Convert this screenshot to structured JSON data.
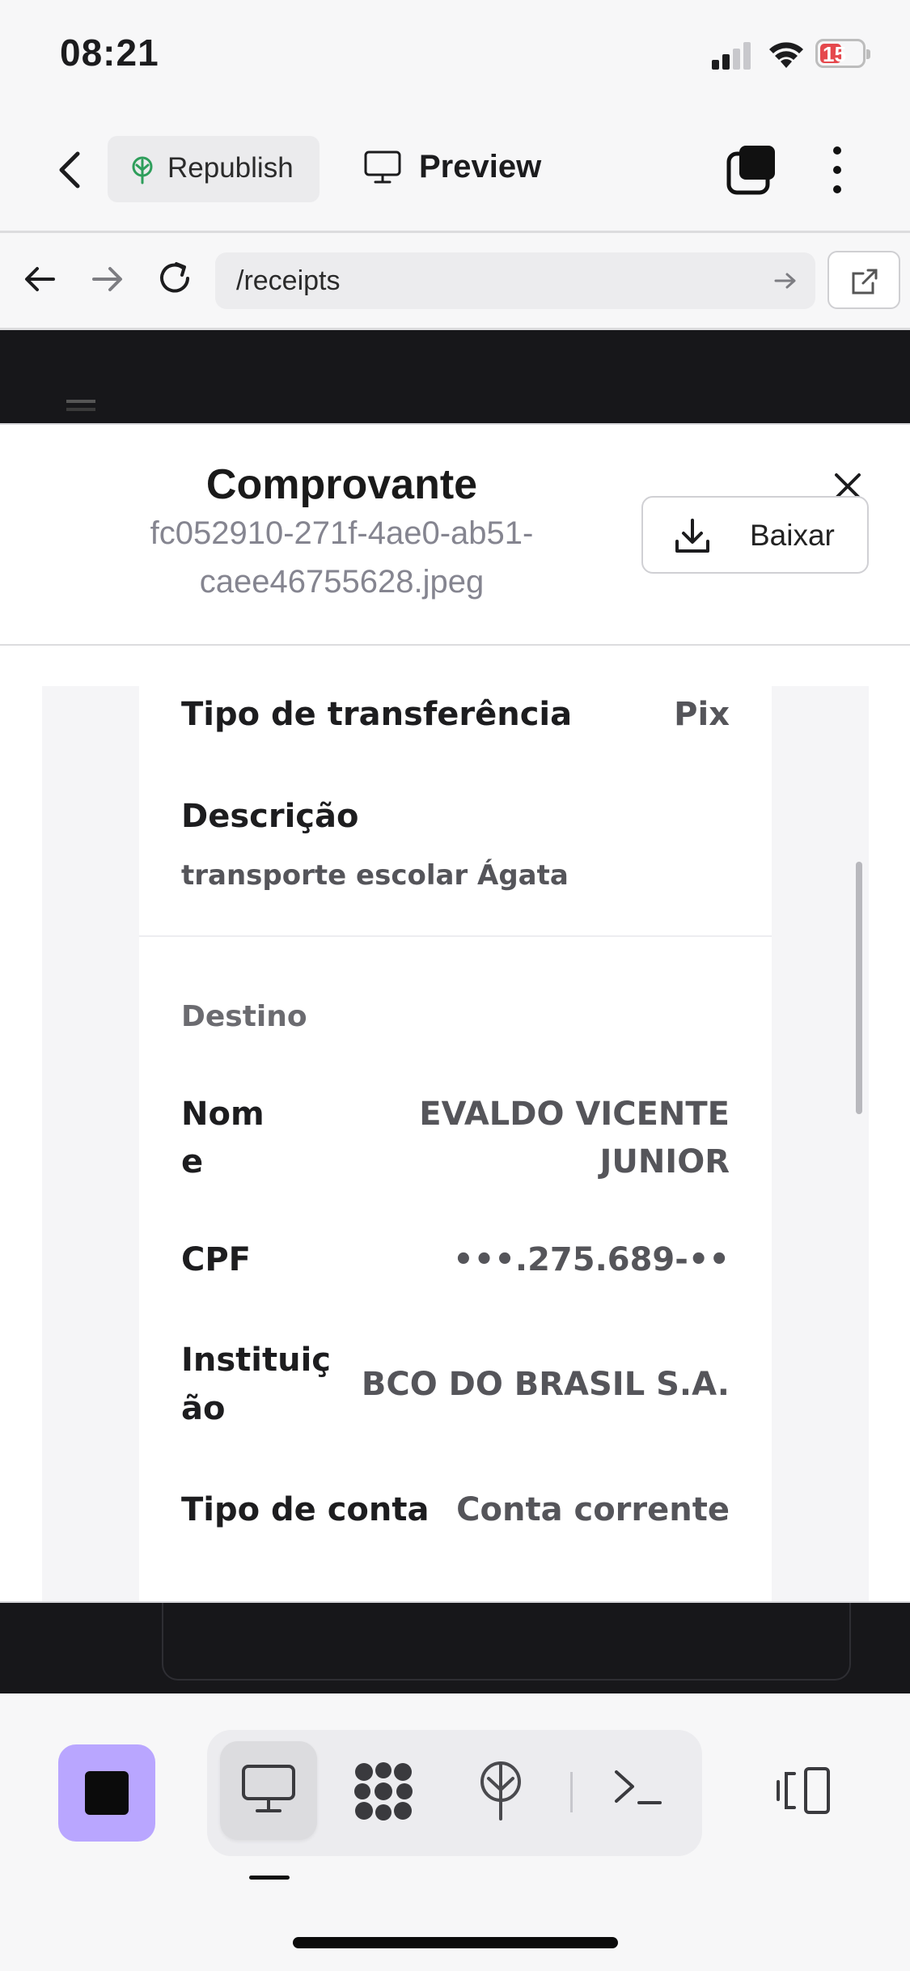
{
  "status_bar": {
    "time": "08:21",
    "battery": "15"
  },
  "toolbar": {
    "republish_label": "Republish",
    "preview_label": "Preview"
  },
  "browser": {
    "url": "/receipts"
  },
  "modal": {
    "title": "Comprovante",
    "filename": "fc052910-271f-4ae0-ab51-caee46755628.jpeg",
    "download_label": "Baixar"
  },
  "receipt": {
    "transfer_type_label": "Tipo de transferência",
    "transfer_type_value": "Pix",
    "description_label": "Descrição",
    "description_value": "transporte escolar Ágata",
    "destination_heading": "Destino",
    "name_label_1": "Nom",
    "name_label_2": "e",
    "name_value_1": "EVALDO VICENTE",
    "name_value_2": "JUNIOR",
    "cpf_label": "CPF",
    "cpf_value": "•••.275.689-••",
    "institution_label_1": "Instituiç",
    "institution_label_2": "ão",
    "institution_value": "BCO DO BRASIL S.A.",
    "account_type_label": "Tipo de conta",
    "account_type_value": "Conta corrente"
  },
  "colors": {
    "accent_purple": "#b9a6ff",
    "battery_red": "#e5484d",
    "republish_green": "#2e9e5b"
  }
}
